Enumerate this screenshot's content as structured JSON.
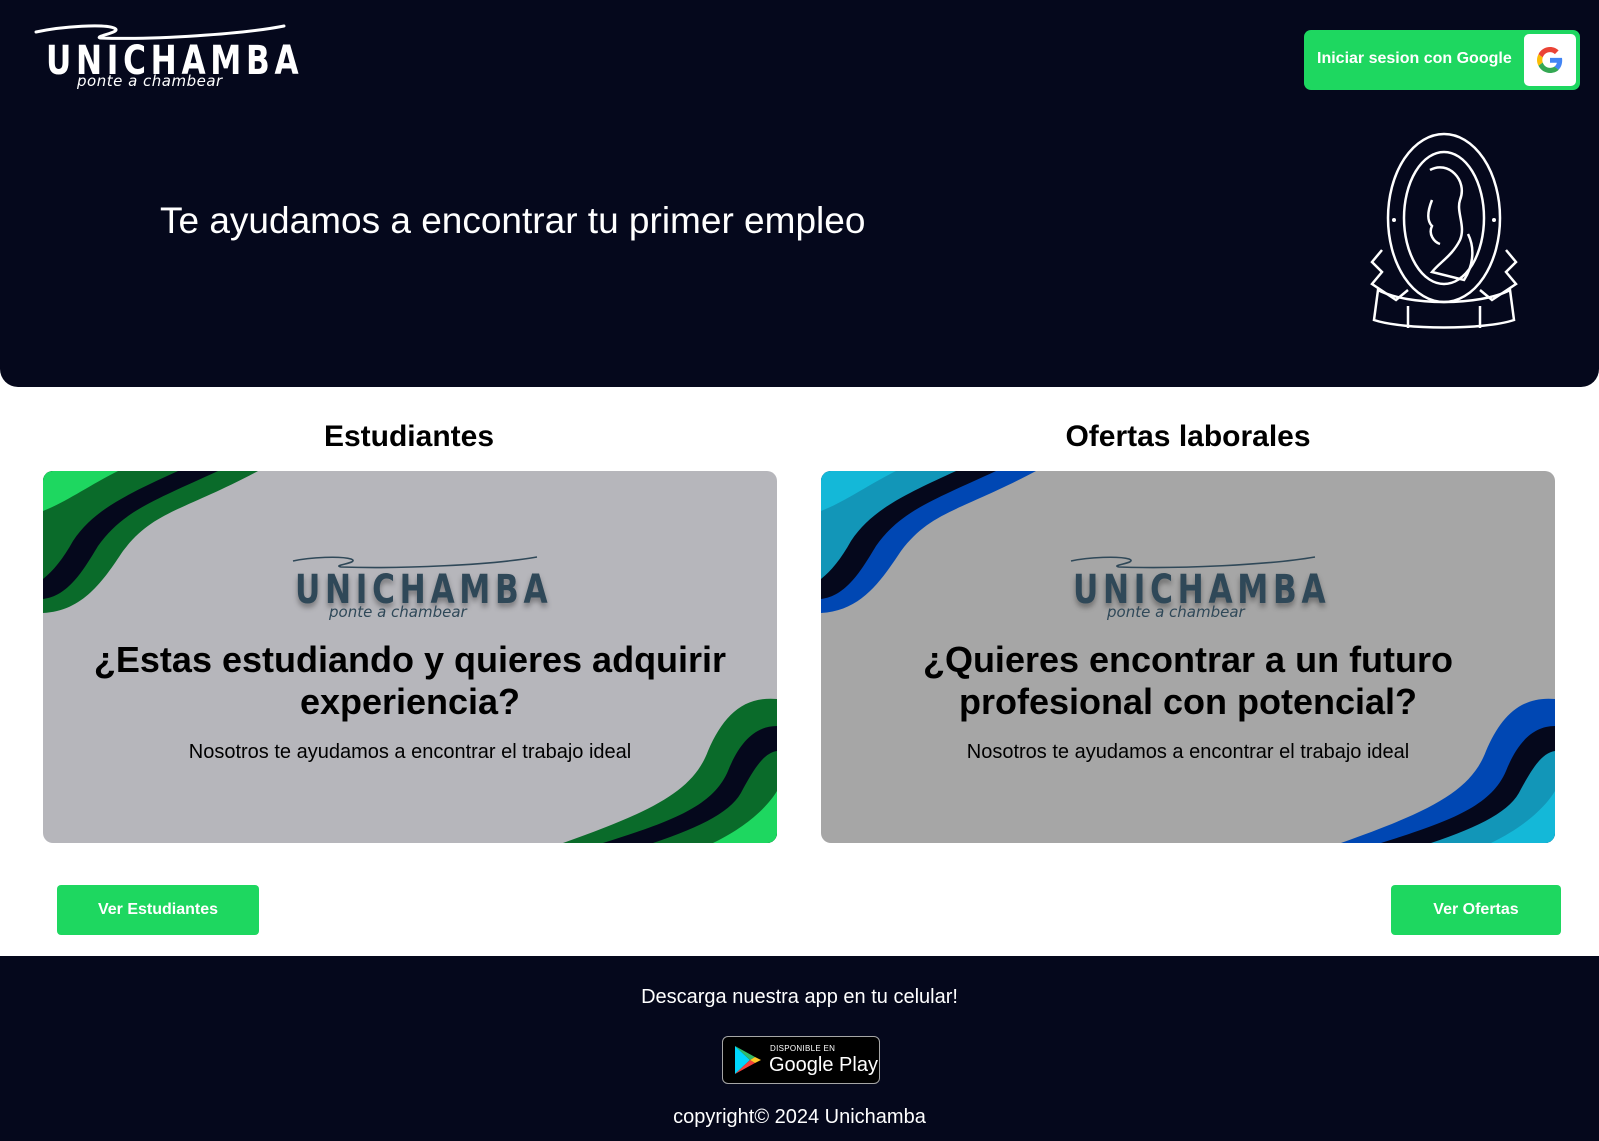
{
  "header": {
    "logo": {
      "wordmark": "UNICHAMBA",
      "tagline": "ponte a chambear"
    },
    "login_button": {
      "label": "Iniciar sesion con Google",
      "icon": "google-g-icon"
    },
    "seal_icon": "university-seal-icon"
  },
  "hero": {
    "title": "Te ayudamos a encontrar tu primer empleo"
  },
  "sections": {
    "students": {
      "title": "Estudiantes",
      "card": {
        "logo_wordmark": "UNICHAMBA",
        "logo_tagline": "ponte a chambear",
        "headline": "¿Estas estudiando y quieres adquirir experiencia?",
        "subtitle": "Nosotros te ayudamos a encontrar el trabajo ideal",
        "background": "#b6b6bb",
        "wave_colors": [
          "#1ed760",
          "#05081c",
          "#0a6b2a"
        ]
      },
      "button_label": "Ver Estudiantes"
    },
    "offers": {
      "title": "Ofertas laborales",
      "card": {
        "logo_wordmark": "UNICHAMBA",
        "logo_tagline": "ponte a chambear",
        "headline": "¿Quieres encontrar a un futuro profesional con potencial?",
        "subtitle": "Nosotros te ayudamos a encontrar el trabajo ideal",
        "background": "#a6a6a6",
        "wave_colors": [
          "#14b8d8",
          "#05081c",
          "#0047b3"
        ]
      },
      "button_label": "Ver Ofertas"
    }
  },
  "footer": {
    "download_text": "Descarga nuestra app en tu celular!",
    "store_badge": {
      "small_text": "DISPONIBLE EN",
      "big_text": "Google Play",
      "icon": "google-play-icon"
    },
    "copyright": "copyright© 2024 Unichamba"
  },
  "colors": {
    "primary_dark": "#05081c",
    "accent_green": "#1ed760",
    "white": "#ffffff"
  }
}
